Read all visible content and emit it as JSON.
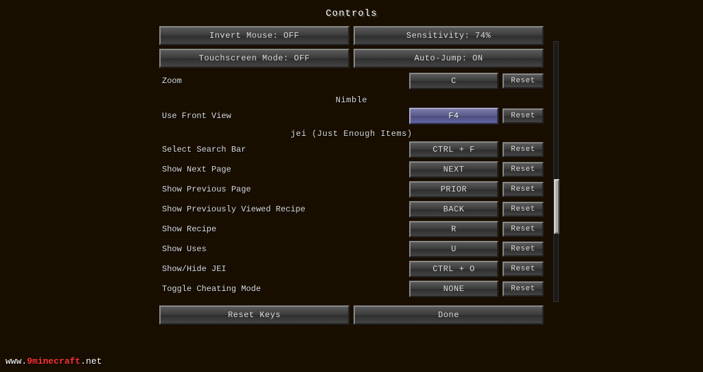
{
  "title": "Controls",
  "top_row1": {
    "button1": "Invert Mouse: OFF",
    "button2": "Sensitivity: 74%"
  },
  "top_row2": {
    "button1": "Touchscreen Mode: OFF",
    "button2": "Auto-Jump: ON"
  },
  "zoom": {
    "label": "Zoom",
    "key": "C",
    "reset": "Reset"
  },
  "nimble": {
    "title": "Nimble",
    "use_front_view": {
      "label": "Use Front View",
      "key": "F4",
      "reset": "Reset"
    }
  },
  "jei": {
    "title": "jei (Just Enough Items)",
    "items": [
      {
        "label": "Select Search Bar",
        "key": "CTRL + F",
        "reset": "Reset"
      },
      {
        "label": "Show Next Page",
        "key": "NEXT",
        "reset": "Reset"
      },
      {
        "label": "Show Previous Page",
        "key": "PRIOR",
        "reset": "Reset"
      },
      {
        "label": "Show Previously Viewed Recipe",
        "key": "BACK",
        "reset": "Reset"
      },
      {
        "label": "Show Recipe",
        "key": "R",
        "reset": "Reset"
      },
      {
        "label": "Show Uses",
        "key": "U",
        "reset": "Reset"
      },
      {
        "label": "Show/Hide JEI",
        "key": "CTRL + O",
        "reset": "Reset"
      },
      {
        "label": "Toggle Cheating Mode",
        "key": "NONE",
        "reset": "Reset"
      }
    ]
  },
  "bottom": {
    "reset_keys": "Reset Keys",
    "done": "Done"
  },
  "watermark": {
    "prefix": "www.",
    "brand": "9minecraft",
    "suffix": ".net"
  }
}
